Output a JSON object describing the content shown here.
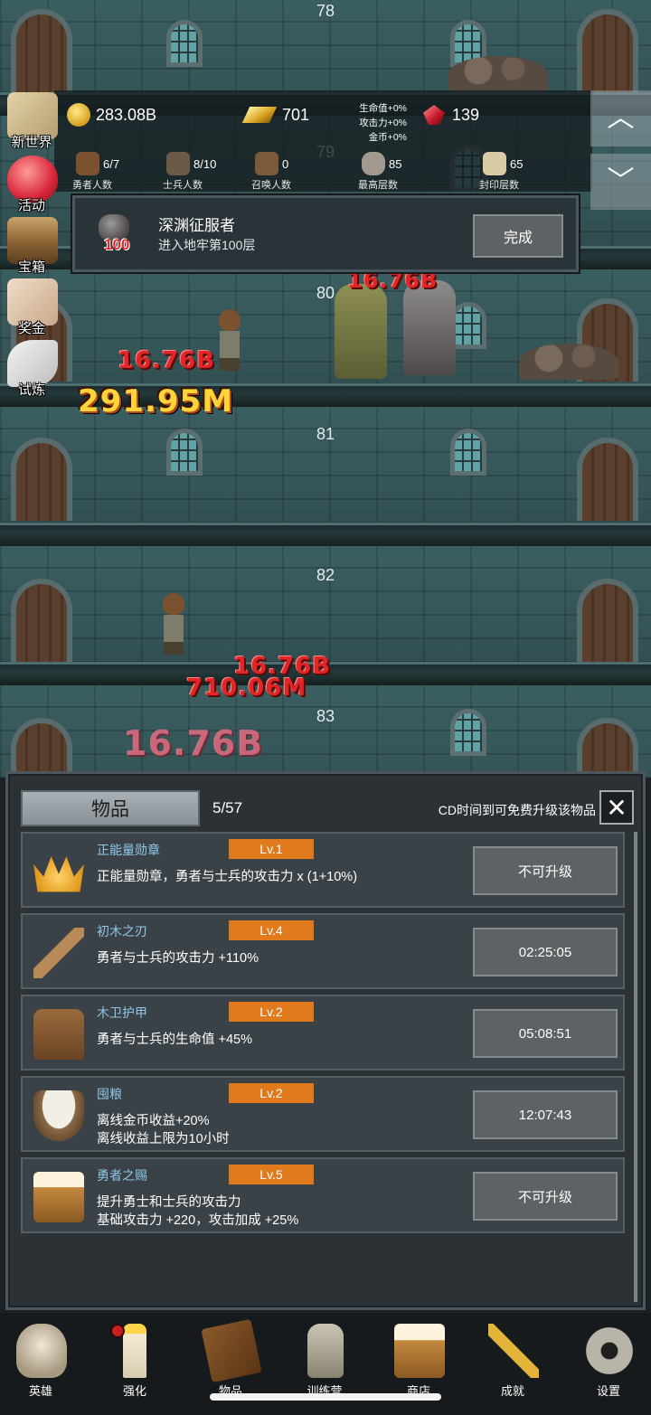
{
  "scene": {
    "floors": [
      "78",
      "79",
      "80",
      "81",
      "82",
      "83"
    ],
    "damage_numbers": [
      "16.76B",
      "16.76B",
      "291.95M",
      "16.76B",
      "710.06M",
      "16.76B"
    ]
  },
  "hud": {
    "coins": "283.08B",
    "gold_bars": "701",
    "rubies": "139",
    "bonus_hp": "生命值+0%",
    "bonus_atk": "攻击力+0%",
    "bonus_coin": "金币+0%",
    "stats": [
      {
        "value": "6/7",
        "label": "勇者人数",
        "icon": "hero-icon"
      },
      {
        "value": "8/10",
        "label": "士兵人数",
        "icon": "soldier-icon"
      },
      {
        "value": "0",
        "label": "召唤人数",
        "icon": "summon-icon"
      },
      {
        "value": "85",
        "label": "最高层数",
        "icon": "rock-icon"
      },
      {
        "value": "65",
        "label": "封印层数",
        "icon": "scroll-icon"
      }
    ]
  },
  "side_menu": [
    {
      "label": "新世界",
      "icon": "map-icon"
    },
    {
      "label": "活动",
      "icon": "heart-icon"
    },
    {
      "label": "宝箱",
      "icon": "chest-icon"
    },
    {
      "label": "奖金",
      "icon": "envelope-icon"
    },
    {
      "label": "试炼",
      "icon": "feather-icon"
    }
  ],
  "achievement": {
    "badge_number": "100",
    "title": "深渊征服者",
    "description": "进入地牢第100层",
    "button": "完成"
  },
  "panel": {
    "tab_label": "物品",
    "count": "5/57",
    "hint": "CD时间到可免费升级该物品",
    "items": [
      {
        "name": "正能量勋章",
        "level": "Lv.1",
        "line1": "正能量勋章，勇者与士兵的攻击力 x (1+10%)",
        "line2": "",
        "button": "不可升级",
        "icon": "crown-icon"
      },
      {
        "name": "初木之刃",
        "level": "Lv.4",
        "line1": "勇者与士兵的攻击力 +110%",
        "line2": "",
        "button": "02:25:05",
        "icon": "wooden-sword-icon"
      },
      {
        "name": "木卫护甲",
        "level": "Lv.2",
        "line1": "勇者与士兵的生命值 +45%",
        "line2": "",
        "button": "05:08:51",
        "icon": "armor-icon"
      },
      {
        "name": "囤粮",
        "level": "Lv.2",
        "line1": "离线金币收益+20%",
        "line2": "离线收益上限为10小时",
        "button": "12:07:43",
        "icon": "rice-bowl-icon"
      },
      {
        "name": "勇者之赐",
        "level": "Lv.5",
        "line1": "提升勇士和士兵的攻击力",
        "line2": "基础攻击力 +220，攻击加成 +25%",
        "button": "不可升级",
        "icon": "beer-mug-icon"
      }
    ]
  },
  "nav": [
    {
      "label": "英雄",
      "icon": "skull-icon"
    },
    {
      "label": "强化",
      "icon": "candle-icon"
    },
    {
      "label": "物品",
      "icon": "book-icon"
    },
    {
      "label": "训练营",
      "icon": "lantern-icon"
    },
    {
      "label": "商店",
      "icon": "beer-mug-icon"
    },
    {
      "label": "成就",
      "icon": "key-icon"
    },
    {
      "label": "设置",
      "icon": "gear-icon"
    }
  ]
}
